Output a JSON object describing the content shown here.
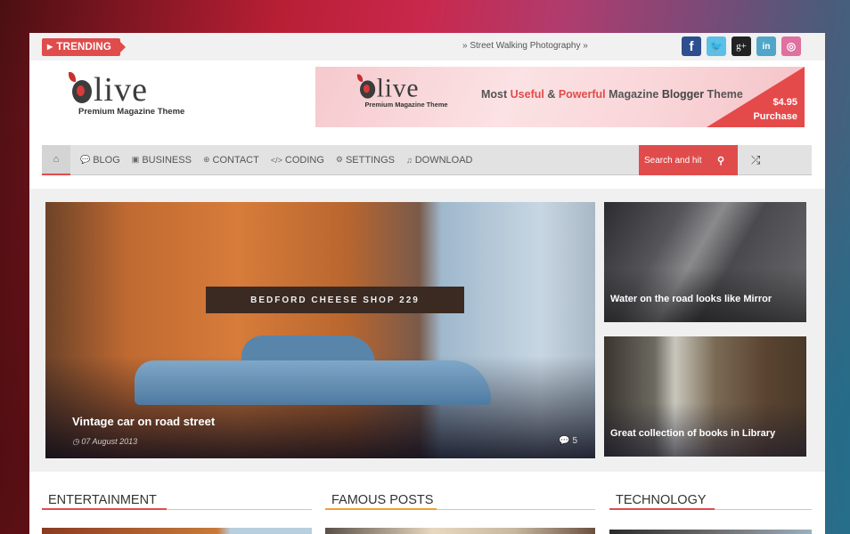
{
  "topbar": {
    "trending_label": "TRENDING",
    "ticker_text": "» Street Walking Photography  »",
    "social": [
      {
        "name": "facebook",
        "glyph": "f"
      },
      {
        "name": "twitter",
        "glyph": "🐦"
      },
      {
        "name": "google-plus",
        "glyph": "g+"
      },
      {
        "name": "linkedin",
        "glyph": "in"
      },
      {
        "name": "dribbble",
        "glyph": "◎"
      }
    ]
  },
  "header": {
    "logo_text": "live",
    "logo_tagline": "Premium Magazine Theme",
    "banner": {
      "logo_text": "live",
      "logo_tagline": "Premium Magazine Theme",
      "headline_parts": [
        "Most ",
        "Useful",
        " & ",
        "Powerful",
        " Magazine ",
        "Blogger",
        " Theme"
      ],
      "price": "$4.95",
      "cta": "Purchase"
    }
  },
  "nav": {
    "home_icon": "home-icon",
    "items": [
      {
        "label": "BLOG",
        "icon": "comments-icon",
        "glyph": "💬"
      },
      {
        "label": "BUSINESS",
        "icon": "money-icon",
        "glyph": "▣"
      },
      {
        "label": "CONTACT",
        "icon": "globe-icon",
        "glyph": "⊕"
      },
      {
        "label": "CODING",
        "icon": "code-icon",
        "glyph": "</>"
      },
      {
        "label": "SETTINGS",
        "icon": "gear-icon",
        "glyph": "⚙"
      },
      {
        "label": "DOWNLOAD",
        "icon": "music-icon",
        "glyph": "♫"
      }
    ],
    "search_placeholder": "Search and hit",
    "accent_color": "#e04c4c"
  },
  "featured": {
    "main": {
      "title": "Vintage car on road street",
      "date": "07 August 2013",
      "comments": "5",
      "sign_text": "BEDFORD CHEESE SHOP 229"
    },
    "side": [
      {
        "title": "Water on the road looks like Mirror"
      },
      {
        "title": "Great collection of books in Library"
      }
    ]
  },
  "sections": [
    {
      "title": "ENTERTAINMENT",
      "accent": "#e04c4c"
    },
    {
      "title": "FAMOUS POSTS",
      "accent": "#f0a030"
    },
    {
      "title": "TECHNOLOGY",
      "accent": "#e04c4c"
    }
  ]
}
